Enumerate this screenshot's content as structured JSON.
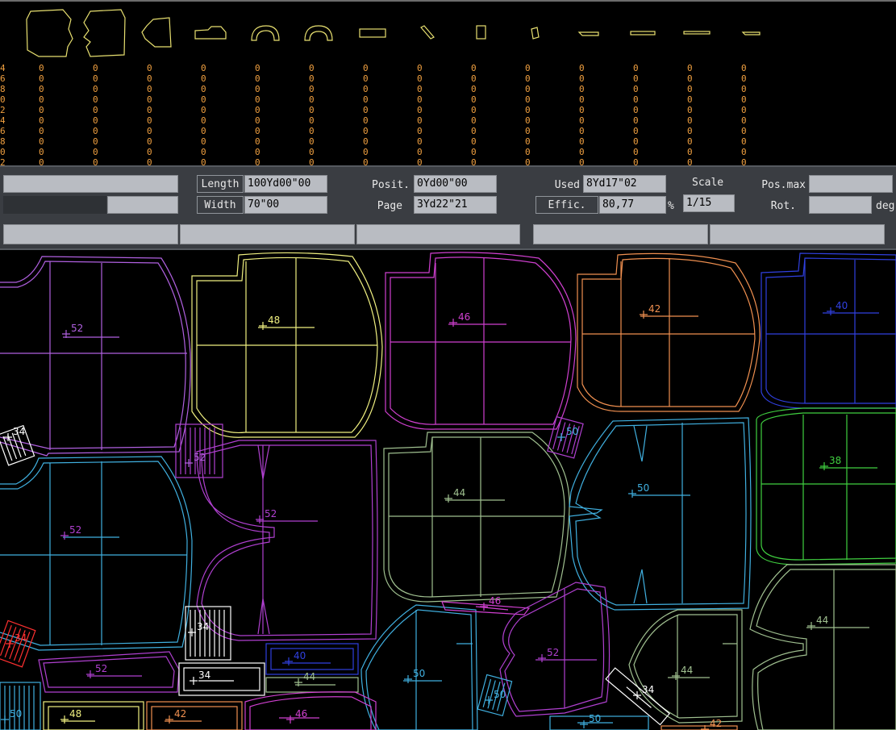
{
  "piece_strip": {
    "columns": [
      {
        "id": "front-bodice",
        "color": "#e8e070"
      },
      {
        "id": "back-bodice",
        "color": "#e8e070"
      },
      {
        "id": "sleeve",
        "color": "#e8e070"
      },
      {
        "id": "collar",
        "color": "#e8e070"
      },
      {
        "id": "arch-piece-1",
        "color": "#e8e070"
      },
      {
        "id": "arch-piece-2",
        "color": "#e8e070"
      },
      {
        "id": "rectangle-piece",
        "color": "#e8e070"
      },
      {
        "id": "diagonal-strip",
        "color": "#e8e070"
      },
      {
        "id": "small-rect-1",
        "color": "#e8e070"
      },
      {
        "id": "small-rect-2",
        "color": "#e8e070"
      },
      {
        "id": "thin-strip-1",
        "color": "#e8e070"
      },
      {
        "id": "thin-strip-2",
        "color": "#e8e070"
      },
      {
        "id": "thin-strip-3",
        "color": "#e8e070"
      },
      {
        "id": "thin-strip-4",
        "color": "#e8e070"
      }
    ],
    "counts_left_edge": [
      "4",
      "6",
      "8",
      "0",
      "2",
      "4",
      "6",
      "8",
      "0",
      "2"
    ],
    "counts": [
      "0",
      "0",
      "0",
      "0",
      "0",
      "0",
      "0",
      "0",
      "0",
      "0"
    ],
    "count_color": "#f0a040"
  },
  "panel": {
    "length_label": "Length",
    "length_value": "100Yd00\"00",
    "width_label": "Width",
    "width_value": "70\"00",
    "posit_label": "Posit.",
    "posit_value": "0Yd00\"00",
    "page_label": "Page",
    "page_value": "3Yd22\"21",
    "used_label": "Used",
    "used_value": "8Yd17\"02",
    "effic_label": "Effic.",
    "effic_value": "80,77",
    "effic_unit": "%",
    "scale_label": "Scale",
    "scale_value": "1/15",
    "posmax_label": "Pos.max",
    "posmax_value": "",
    "rot_label": "Rot.",
    "rot_value": "",
    "rot_unit": "deg"
  },
  "marker": {
    "pieces": [
      {
        "size": "52",
        "color": "#b060e0"
      },
      {
        "size": "48",
        "color": "#f0f080"
      },
      {
        "size": "46",
        "color": "#d040d0"
      },
      {
        "size": "42",
        "color": "#f09050"
      },
      {
        "size": "40",
        "color": "#3040e0"
      },
      {
        "size": "52",
        "color": "#b060e0"
      },
      {
        "size": "52",
        "color": "#b040d0"
      },
      {
        "size": "44",
        "color": "#a0c090"
      },
      {
        "size": "52",
        "color": "#b040d0"
      },
      {
        "size": "50",
        "color": "#40b0e0"
      },
      {
        "size": "38",
        "color": "#40d040"
      },
      {
        "size": "50",
        "color": "#40b0e0"
      },
      {
        "size": "52",
        "color": "#b040d0"
      },
      {
        "size": "44",
        "color": "#a0c090"
      },
      {
        "size": "34",
        "color": "#ffffff"
      },
      {
        "size": "46",
        "color": "#d040d0"
      },
      {
        "size": "52",
        "color": "#b040d0"
      },
      {
        "size": "50",
        "color": "#40b0e0"
      },
      {
        "size": "40",
        "color": "#3040e0"
      },
      {
        "size": "44",
        "color": "#a0c090"
      },
      {
        "size": "34",
        "color": "#ffffff"
      },
      {
        "size": "44",
        "color": "#a0c090"
      },
      {
        "size": "50",
        "color": "#40b0e0"
      },
      {
        "size": "34",
        "color": "#ffffff"
      },
      {
        "size": "42",
        "color": "#f09050"
      },
      {
        "size": "48",
        "color": "#f0f080"
      },
      {
        "size": "42",
        "color": "#f09050"
      },
      {
        "size": "46",
        "color": "#d040d0"
      },
      {
        "size": "50",
        "color": "#40b0e0"
      },
      {
        "size": "50",
        "color": "#40b0e0"
      },
      {
        "size": "34",
        "color": "#ff3030"
      },
      {
        "size": "34",
        "color": "#ffffff"
      }
    ]
  }
}
